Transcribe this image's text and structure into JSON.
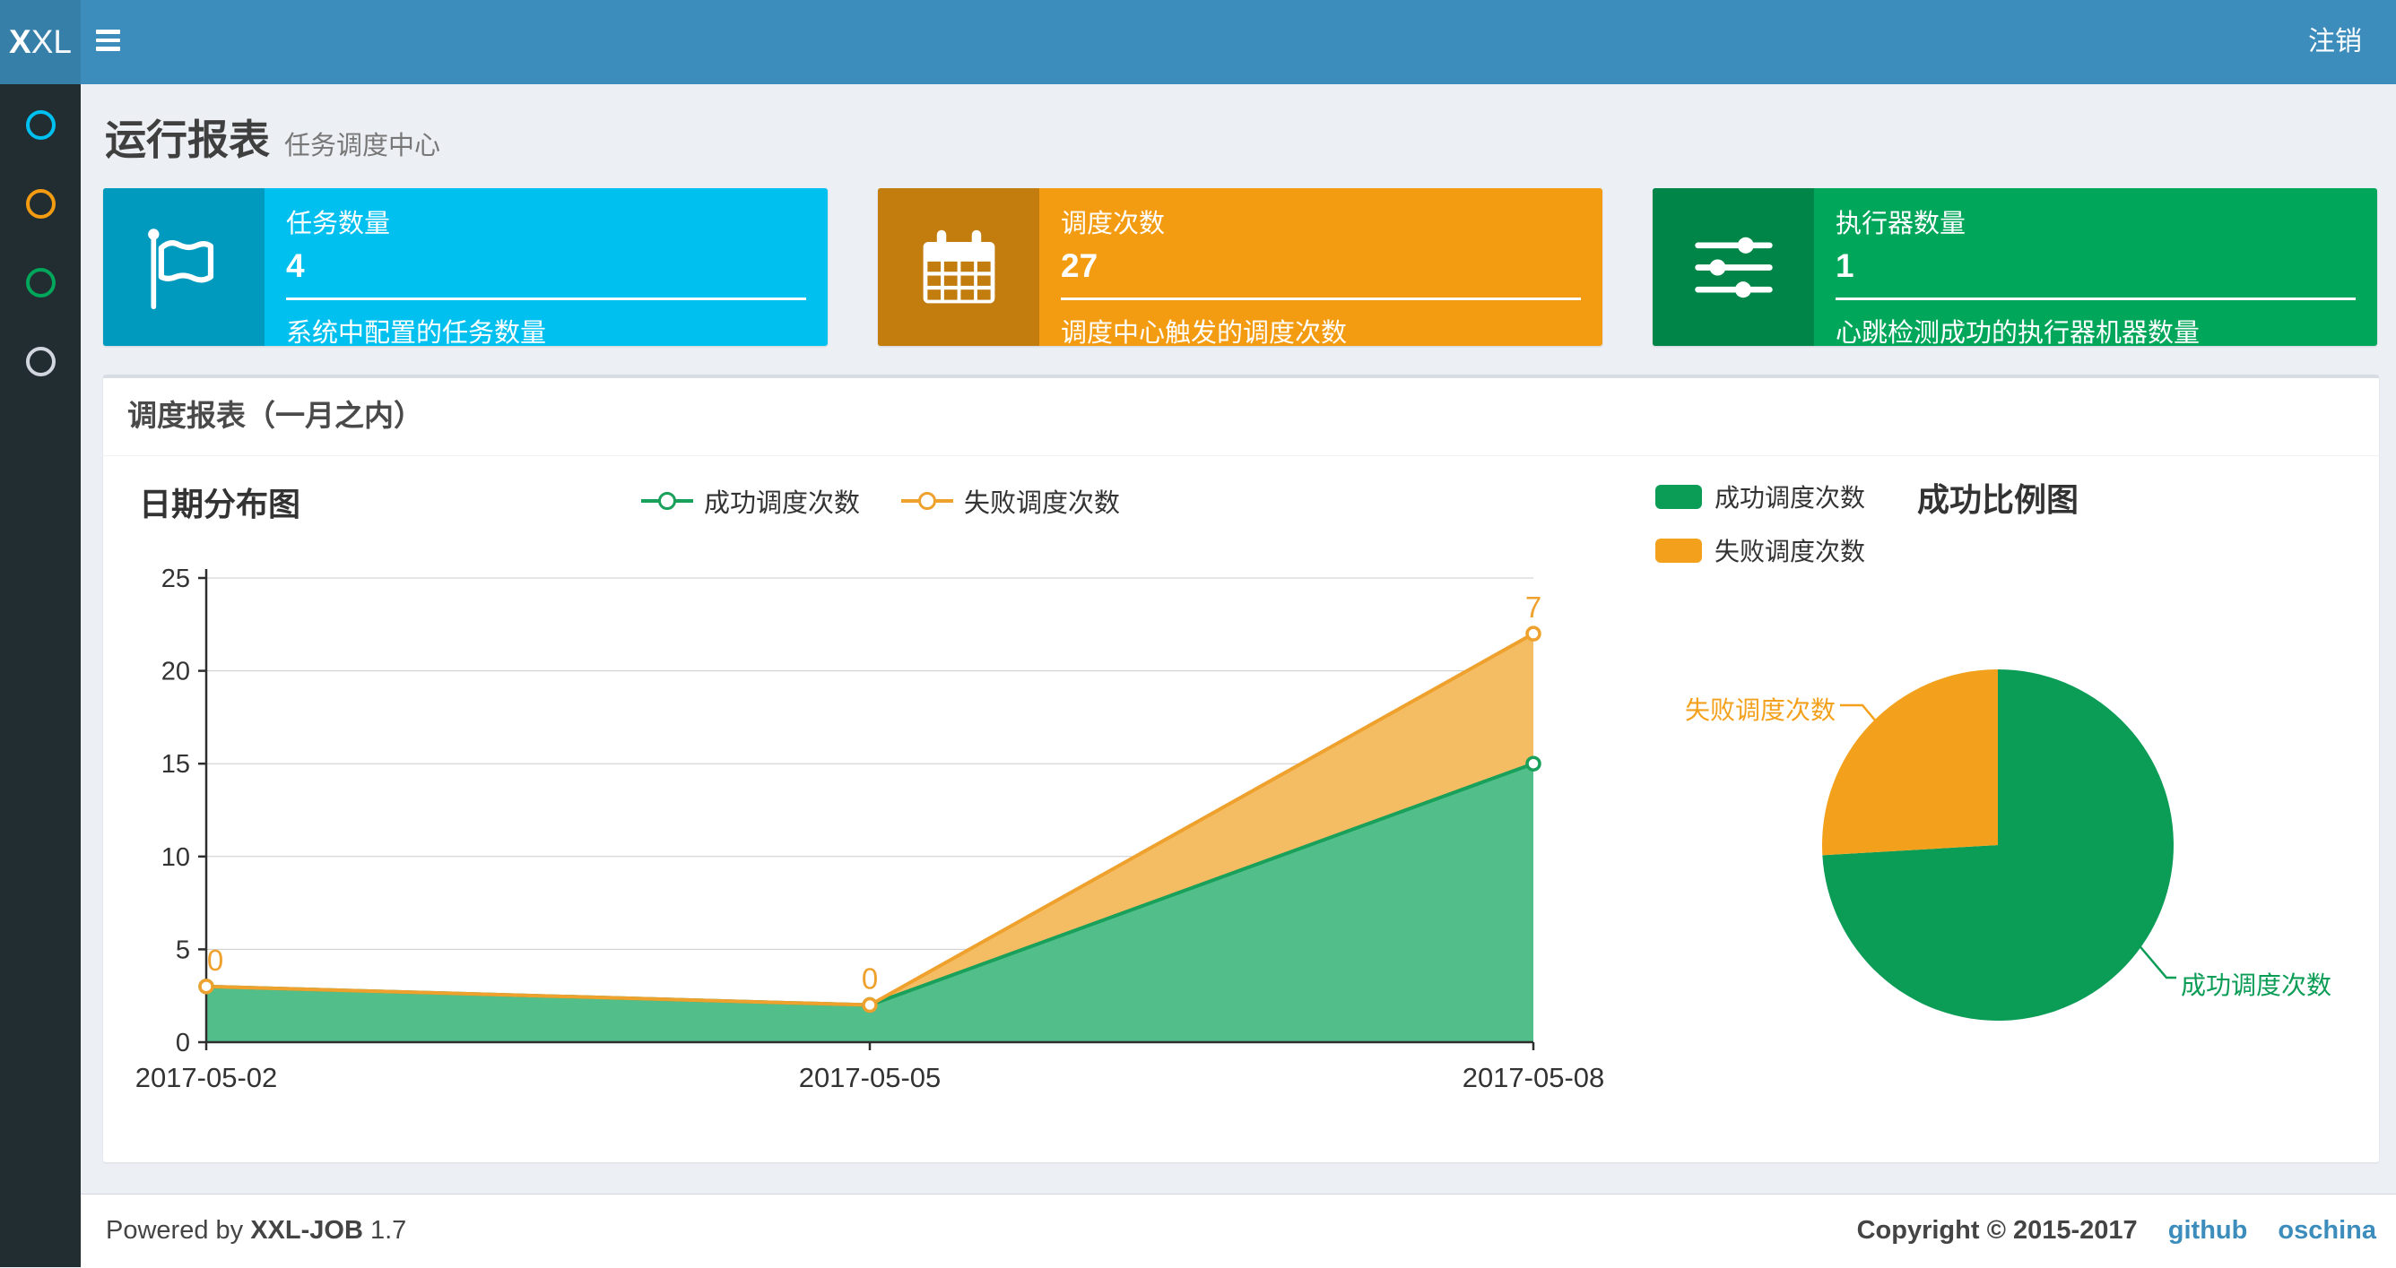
{
  "navbar": {
    "logo_bold": "X",
    "logo_rest": "XL",
    "logout": "注销"
  },
  "sidebar": {
    "items": [
      {
        "icon": "circle-outline-icon",
        "color": "#00c0ef"
      },
      {
        "icon": "circle-outline-icon",
        "color": "#f39c12"
      },
      {
        "icon": "circle-outline-icon",
        "color": "#00a65a"
      },
      {
        "icon": "circle-outline-icon",
        "color": "#d2d6de"
      }
    ]
  },
  "page_header": {
    "title": "运行报表",
    "subtitle": "任务调度中心"
  },
  "info_boxes": [
    {
      "title": "任务数量",
      "value": "4",
      "description": "系统中配置的任务数量",
      "color": "#00c0ef",
      "icon_color": "#009abf",
      "icon": "flag-icon"
    },
    {
      "title": "调度次数",
      "value": "27",
      "description": "调度中心触发的调度次数",
      "color": "#f39c12",
      "icon_color": "#c27d0e",
      "icon": "calendar-icon"
    },
    {
      "title": "执行器数量",
      "value": "1",
      "description": "心跳检测成功的执行器机器数量",
      "color": "#00a65a",
      "icon_color": "#008548",
      "icon": "sliders-icon"
    }
  ],
  "panel": {
    "title": "调度报表（一月之内）"
  },
  "chart_data": [
    {
      "type": "area",
      "title": "日期分布图",
      "x": [
        "2017-05-02",
        "2017-05-05",
        "2017-05-08"
      ],
      "series": [
        {
          "name": "成功调度次数",
          "values": [
            3,
            2,
            15
          ],
          "color": "#19a05b",
          "fill": "#52bf8b"
        },
        {
          "name": "失败调度次数",
          "values": [
            0,
            0,
            7
          ],
          "color": "#efa12e",
          "fill": "#f4bd63",
          "labels": [
            "0",
            "0",
            "7"
          ]
        }
      ],
      "stacked": true,
      "ylim": [
        0,
        25
      ],
      "yticks": [
        0,
        5,
        10,
        15,
        20,
        25
      ],
      "xlabel": "",
      "ylabel": "",
      "grid": true,
      "legend_position": "top-center"
    },
    {
      "type": "pie",
      "title": "成功比例图",
      "slices": [
        {
          "name": "成功调度次数",
          "value": 20,
          "color": "#0b9c56"
        },
        {
          "name": "失败调度次数",
          "value": 7,
          "color": "#f3a11c"
        }
      ],
      "legend_position": "top-left"
    }
  ],
  "footer": {
    "powered_prefix": "Powered by",
    "brand": "XXL-JOB",
    "version": "1.7",
    "copyright": "Copyright © 2015-2017",
    "links": [
      "github",
      "oschina"
    ]
  }
}
